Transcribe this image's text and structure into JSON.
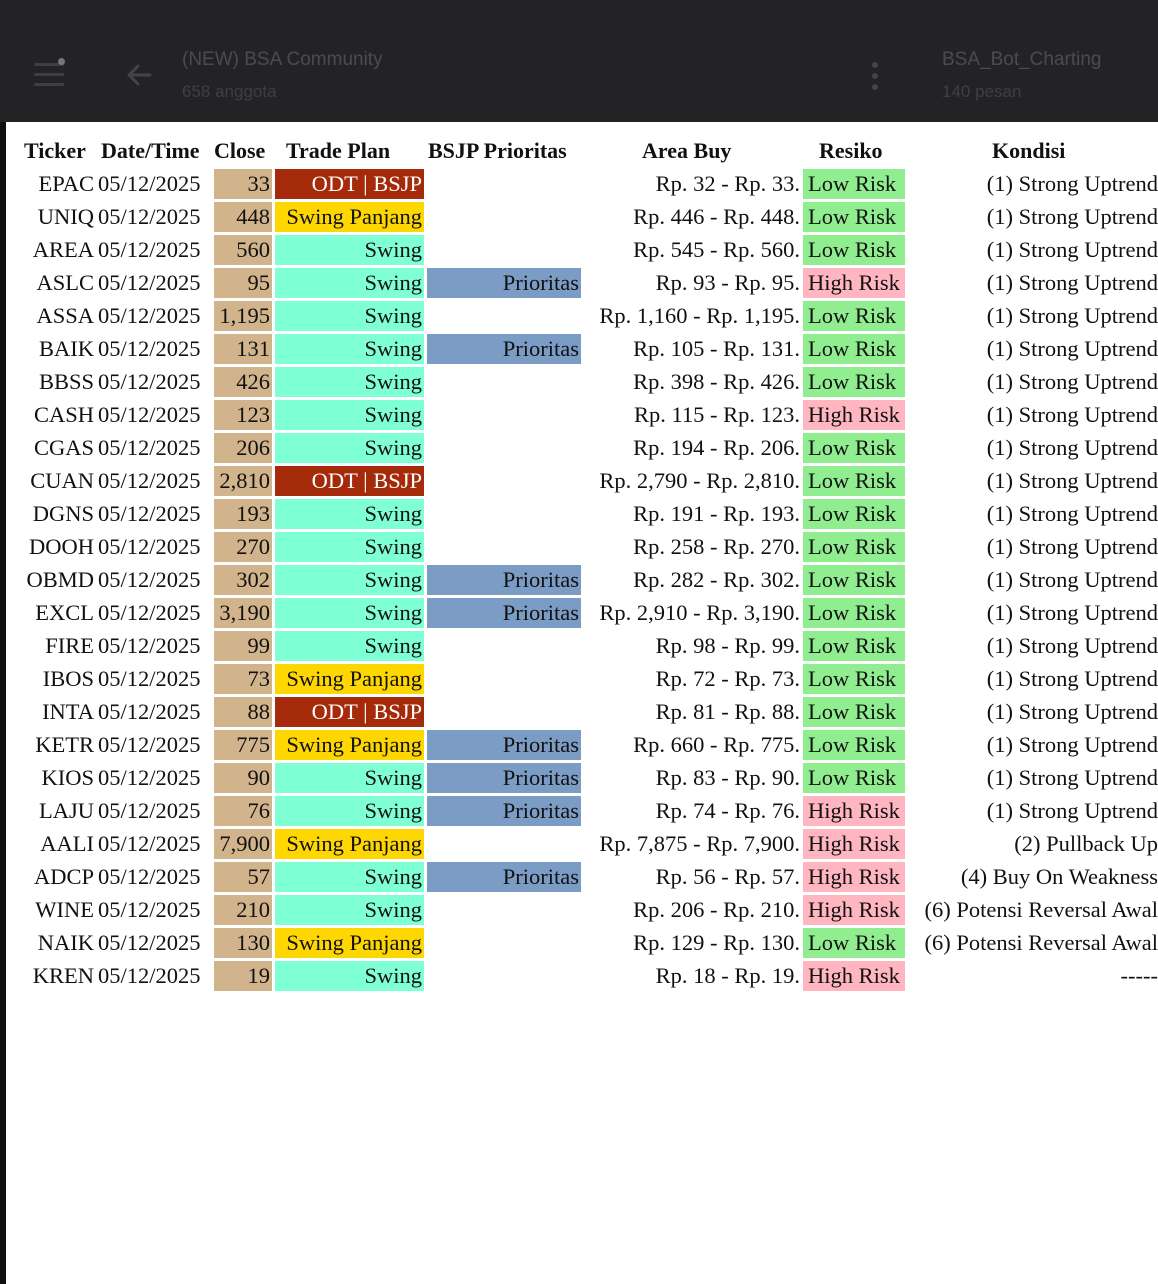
{
  "chat": {
    "title": "(NEW) BSA Community",
    "members": "658 anggota",
    "bot_title": "BSA_Bot_Charting",
    "bot_messages": "140 pesan"
  },
  "table": {
    "headers": {
      "ticker": "Ticker",
      "datetime": "Date/Time",
      "close": "Close",
      "trade_plan": "Trade Plan",
      "prioritas": "BSJP Prioritas",
      "area_buy": "Area Buy",
      "resiko": "Resiko",
      "kondisi": "Kondisi"
    },
    "colors": {
      "close": "#d2b48c",
      "odt": "#a52a0a",
      "swing": "#7fffd4",
      "swing_panjang": "#ffd700",
      "prioritas": "#7b9cc4",
      "low_risk": "#90ee90",
      "high_risk": "#ffb6c1"
    },
    "rows": [
      {
        "ticker": "EPAC",
        "date": "05/12/2025",
        "close": "33",
        "plan": "ODT | BSJP",
        "plan_type": "odt",
        "prio": "",
        "area": "Rp. 32 - Rp. 33.",
        "risk": "Low Risk",
        "risk_type": "low",
        "kondisi": "(1) Strong Uptrend"
      },
      {
        "ticker": "UNIQ",
        "date": "05/12/2025",
        "close": "448",
        "plan": "Swing Panjang",
        "plan_type": "panjang",
        "prio": "",
        "area": "Rp. 446 - Rp. 448.",
        "risk": "Low Risk",
        "risk_type": "low",
        "kondisi": "(1) Strong Uptrend"
      },
      {
        "ticker": "AREA",
        "date": "05/12/2025",
        "close": "560",
        "plan": "Swing",
        "plan_type": "swing",
        "prio": "",
        "area": "Rp. 545 - Rp. 560.",
        "risk": "Low Risk",
        "risk_type": "low",
        "kondisi": "(1) Strong Uptrend"
      },
      {
        "ticker": "ASLC",
        "date": "05/12/2025",
        "close": "95",
        "plan": "Swing",
        "plan_type": "swing",
        "prio": "Prioritas",
        "area": "Rp. 93 - Rp. 95.",
        "risk": "High Risk",
        "risk_type": "high",
        "kondisi": "(1) Strong Uptrend"
      },
      {
        "ticker": "ASSA",
        "date": "05/12/2025",
        "close": "1,195",
        "plan": "Swing",
        "plan_type": "swing",
        "prio": "",
        "area": "Rp. 1,160 - Rp. 1,195.",
        "risk": "Low Risk",
        "risk_type": "low",
        "kondisi": "(1) Strong Uptrend"
      },
      {
        "ticker": "BAIK",
        "date": "05/12/2025",
        "close": "131",
        "plan": "Swing",
        "plan_type": "swing",
        "prio": "Prioritas",
        "area": "Rp. 105 - Rp. 131.",
        "risk": "Low Risk",
        "risk_type": "low",
        "kondisi": "(1) Strong Uptrend"
      },
      {
        "ticker": "BBSS",
        "date": "05/12/2025",
        "close": "426",
        "plan": "Swing",
        "plan_type": "swing",
        "prio": "",
        "area": "Rp. 398 - Rp. 426.",
        "risk": "Low Risk",
        "risk_type": "low",
        "kondisi": "(1) Strong Uptrend"
      },
      {
        "ticker": "CASH",
        "date": "05/12/2025",
        "close": "123",
        "plan": "Swing",
        "plan_type": "swing",
        "prio": "",
        "area": "Rp. 115 - Rp. 123.",
        "risk": "High Risk",
        "risk_type": "high",
        "kondisi": "(1) Strong Uptrend"
      },
      {
        "ticker": "CGAS",
        "date": "05/12/2025",
        "close": "206",
        "plan": "Swing",
        "plan_type": "swing",
        "prio": "",
        "area": "Rp. 194 - Rp. 206.",
        "risk": "Low Risk",
        "risk_type": "low",
        "kondisi": "(1) Strong Uptrend"
      },
      {
        "ticker": "CUAN",
        "date": "05/12/2025",
        "close": "2,810",
        "plan": "ODT | BSJP",
        "plan_type": "odt",
        "prio": "",
        "area": "Rp. 2,790 - Rp. 2,810.",
        "risk": "Low Risk",
        "risk_type": "low",
        "kondisi": "(1) Strong Uptrend"
      },
      {
        "ticker": "DGNS",
        "date": "05/12/2025",
        "close": "193",
        "plan": "Swing",
        "plan_type": "swing",
        "prio": "",
        "area": "Rp. 191 - Rp. 193.",
        "risk": "Low Risk",
        "risk_type": "low",
        "kondisi": "(1) Strong Uptrend"
      },
      {
        "ticker": "DOOH",
        "date": "05/12/2025",
        "close": "270",
        "plan": "Swing",
        "plan_type": "swing",
        "prio": "",
        "area": "Rp. 258 - Rp. 270.",
        "risk": "Low Risk",
        "risk_type": "low",
        "kondisi": "(1) Strong Uptrend"
      },
      {
        "ticker": "OBMD",
        "date": "05/12/2025",
        "close": "302",
        "plan": "Swing",
        "plan_type": "swing",
        "prio": "Prioritas",
        "area": "Rp. 282 - Rp. 302.",
        "risk": "Low Risk",
        "risk_type": "low",
        "kondisi": "(1) Strong Uptrend"
      },
      {
        "ticker": "EXCL",
        "date": "05/12/2025",
        "close": "3,190",
        "plan": "Swing",
        "plan_type": "swing",
        "prio": "Prioritas",
        "area": "Rp. 2,910 - Rp. 3,190.",
        "risk": "Low Risk",
        "risk_type": "low",
        "kondisi": "(1) Strong Uptrend"
      },
      {
        "ticker": "FIRE",
        "date": "05/12/2025",
        "close": "99",
        "plan": "Swing",
        "plan_type": "swing",
        "prio": "",
        "area": "Rp. 98 - Rp. 99.",
        "risk": "Low Risk",
        "risk_type": "low",
        "kondisi": "(1) Strong Uptrend"
      },
      {
        "ticker": "IBOS",
        "date": "05/12/2025",
        "close": "73",
        "plan": "Swing Panjang",
        "plan_type": "panjang",
        "prio": "",
        "area": "Rp. 72 - Rp. 73.",
        "risk": "Low Risk",
        "risk_type": "low",
        "kondisi": "(1) Strong Uptrend"
      },
      {
        "ticker": "INTA",
        "date": "05/12/2025",
        "close": "88",
        "plan": "ODT | BSJP",
        "plan_type": "odt",
        "prio": "",
        "area": "Rp. 81 - Rp. 88.",
        "risk": "Low Risk",
        "risk_type": "low",
        "kondisi": "(1) Strong Uptrend"
      },
      {
        "ticker": "KETR",
        "date": "05/12/2025",
        "close": "775",
        "plan": "Swing Panjang",
        "plan_type": "panjang",
        "prio": "Prioritas",
        "area": "Rp. 660 - Rp. 775.",
        "risk": "Low Risk",
        "risk_type": "low",
        "kondisi": "(1) Strong Uptrend"
      },
      {
        "ticker": "KIOS",
        "date": "05/12/2025",
        "close": "90",
        "plan": "Swing",
        "plan_type": "swing",
        "prio": "Prioritas",
        "area": "Rp. 83 - Rp. 90.",
        "risk": "Low Risk",
        "risk_type": "low",
        "kondisi": "(1) Strong Uptrend"
      },
      {
        "ticker": "LAJU",
        "date": "05/12/2025",
        "close": "76",
        "plan": "Swing",
        "plan_type": "swing",
        "prio": "Prioritas",
        "area": "Rp. 74 - Rp. 76.",
        "risk": "High Risk",
        "risk_type": "high",
        "kondisi": "(1) Strong Uptrend"
      },
      {
        "ticker": "AALI",
        "date": "05/12/2025",
        "close": "7,900",
        "plan": "Swing Panjang",
        "plan_type": "panjang",
        "prio": "",
        "area": "Rp. 7,875 - Rp. 7,900.",
        "risk": "High Risk",
        "risk_type": "high",
        "kondisi": "(2) Pullback Up"
      },
      {
        "ticker": "ADCP",
        "date": "05/12/2025",
        "close": "57",
        "plan": "Swing",
        "plan_type": "swing",
        "prio": "Prioritas",
        "area": "Rp. 56 - Rp. 57.",
        "risk": "High Risk",
        "risk_type": "high",
        "kondisi": "(4) Buy On Weakness"
      },
      {
        "ticker": "WINE",
        "date": "05/12/2025",
        "close": "210",
        "plan": "Swing",
        "plan_type": "swing",
        "prio": "",
        "area": "Rp. 206 - Rp. 210.",
        "risk": "High Risk",
        "risk_type": "high",
        "kondisi": "(6) Potensi Reversal Awal"
      },
      {
        "ticker": "NAIK",
        "date": "05/12/2025",
        "close": "130",
        "plan": "Swing Panjang",
        "plan_type": "panjang",
        "prio": "",
        "area": "Rp. 129 - Rp. 130.",
        "risk": "Low Risk",
        "risk_type": "low",
        "kondisi": "(6) Potensi Reversal Awal"
      },
      {
        "ticker": "KREN",
        "date": "05/12/2025",
        "close": "19",
        "plan": "Swing",
        "plan_type": "swing",
        "prio": "",
        "area": "Rp. 18 - Rp. 19.",
        "risk": "High Risk",
        "risk_type": "high",
        "kondisi": "-----"
      }
    ]
  }
}
